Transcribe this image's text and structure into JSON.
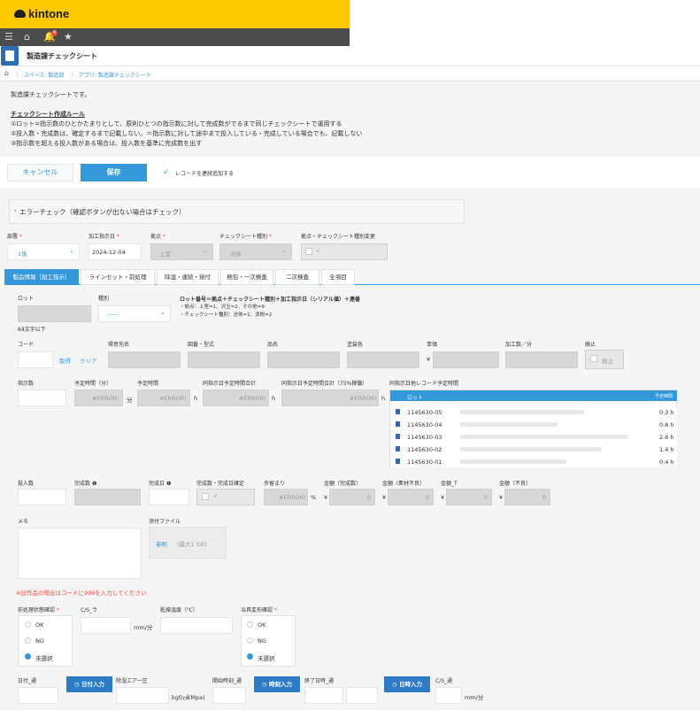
{
  "header": {
    "logo": "kintone",
    "notification_count": "4"
  },
  "app": {
    "title": "製造課チェックシート"
  },
  "breadcrumb": {
    "space": "スペース: 製造部",
    "app": "アプリ: 製造課チェックシート"
  },
  "description": {
    "line1": "製造課チェックシートです。",
    "rule_title": "チェックシート作成ルール",
    "rule1": "①ロット=指示数のひとかたまりとして、原則ひとつの指示数に対して完成数がでるまで同じチェックシートで運用する",
    "rule2": "②投入数・完成数は、確定するまで記載しない。＝指示数に対して途中まで投入している・完成している場合でも、記載しない",
    "rule3": "③指示数を超える投入数がある場合は、投入数を基準に完成数を出す"
  },
  "actions": {
    "cancel": "キャンセル",
    "save": "保存",
    "continuous": "レコードを連続追加する"
  },
  "error_panel": {
    "title": "エラーチェック（確認ボタンが出ない場合はチェック）"
  },
  "top_fields": {
    "dept_label": "部署",
    "dept_value": "1係",
    "date_label": "加工指示日",
    "date_value": "2024-12-04",
    "site_label": "拠点",
    "site_value": "上室",
    "type_label": "チェックシート種別",
    "type_value": "汾体",
    "change_label": "拠点・チェックシート種別変更",
    "change_check": "✓"
  },
  "tabs": [
    "製品情報（加工指示）",
    "ラインセット・前処理",
    "除湿・連続・焼付",
    "梱包・一次検査",
    "二次検査",
    "全項目"
  ],
  "product": {
    "lot_label": "ロット",
    "lot_hint": "64文字以下",
    "kind_label": "種別",
    "kind_value": "-----",
    "lot_rule_title": "ロット番号＝拠点＋チェックシート種別＋加工指示日（シリアル値）＋連番",
    "lot_rule1": "・拠点：上室=1、沢玉=2、その他=9",
    "lot_rule2": "・チェックシート種別：汾体=1、添削=2",
    "code_label": "コード",
    "get": "取得",
    "clear": "クリア",
    "customer_label": "得意先名",
    "drawing_label": "図番・型式",
    "item_label": "品名",
    "color_label": "塗装色",
    "price_label": "単価",
    "yen": "¥",
    "rate_label": "加工数／分",
    "discontinued_label": "廃止",
    "discontinued_value": "廃止",
    "qty_label": "指示数",
    "plan_min_label": "予定時間（分）",
    "err1": "#ERROR!",
    "min": "分",
    "plan_hr_label": "予定時間",
    "err2": "#ERROR!",
    "h1": "h",
    "same_total_label": "同指示日予定時間合計",
    "err3": "#ERROR!",
    "h2": "h",
    "same_75_label": "同指示日予定時間合計（75%稼働）",
    "err4": "#ERROR!",
    "h3": "h",
    "other_label": "同指示日他レコード予定時間"
  },
  "subtable": {
    "headers": [
      "ロット",
      "予定時間"
    ],
    "rows": [
      {
        "lot": "1145630-05",
        "time": "0.3 h"
      },
      {
        "lot": "1145630-04",
        "time": "0.8 h"
      },
      {
        "lot": "1145630-03",
        "time": "2.6 h"
      },
      {
        "lot": "1145630-02",
        "time": "1.4 h"
      },
      {
        "lot": "1145630-01",
        "time": "0.4 h"
      }
    ]
  },
  "output": {
    "input_label": "投入数",
    "done_label": "完成数",
    "done_date_label": "完成日",
    "confirm_label": "完成数・完成日確定",
    "confirm_check": "✓",
    "yield_label": "歩留まり",
    "yield_value": "#ERROR!",
    "pct": "%",
    "amt_done_label": "金額（完成数）",
    "amt_material_label": "金額（素材不良）",
    "amt_t_label": "金額_T",
    "amt_bad_label": "金額（不良）",
    "yen": "¥",
    "zero": "0"
  },
  "memo": {
    "label": "メモ",
    "attach_label": "添付ファイル",
    "browse": "参照",
    "max": "(最大1 GB)"
  },
  "warning": "※試作品の場合はコードに999を入力してください",
  "process": {
    "pre_label": "前処理状態確認",
    "cs_label": "C/S_ラ",
    "mm_min": "mm/分",
    "dry_label": "乾燥温度（℃）",
    "jig_label": "治具変形確認",
    "ok": "OK",
    "ng": "NG",
    "unselected": "未選択"
  },
  "dates": {
    "date_label": "日付_通",
    "date_btn": "日付入力",
    "air_label": "除湿エアー圧",
    "air_unit": "kgf/㎠(Mpa)",
    "start_label": "開始時刻_通",
    "time_btn": "時刻入力",
    "end_label": "終了日時_通",
    "datetime_btn": "日時入力",
    "cs2_label": "C/S_通",
    "mm_min": "mm/分"
  },
  "colors": {
    "accent": "#3498db",
    "header": "#fcc800",
    "dark": "#4b4b4b",
    "error": "#e74c3c"
  },
  "icons": [
    "menu-icon",
    "home-icon",
    "bell-icon",
    "star-icon",
    "check-icon",
    "chevron-right-icon",
    "chevron-down-icon",
    "clock-icon",
    "file-icon",
    "help-icon"
  ]
}
